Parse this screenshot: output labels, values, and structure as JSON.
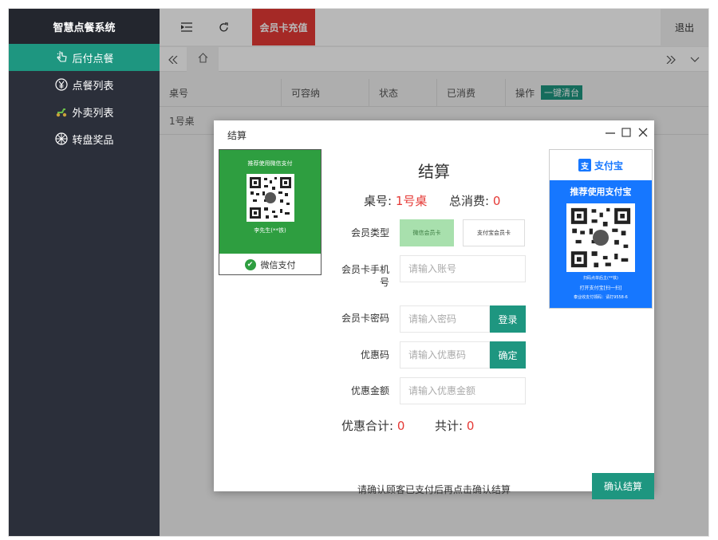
{
  "sidebar": {
    "app_title": "智慧点餐系统",
    "items": [
      {
        "label": "后付点餐",
        "active": true,
        "icon": "hand-pointer-icon"
      },
      {
        "label": "点餐列表",
        "active": false,
        "icon": "yen-icon"
      },
      {
        "label": "外卖列表",
        "active": false,
        "icon": "scooter-icon"
      },
      {
        "label": "转盘奖品",
        "active": false,
        "icon": "wheel-icon"
      }
    ]
  },
  "header": {
    "menu_icon": "menu-fold-icon",
    "refresh_icon": "refresh-icon",
    "recharge_label": "会员卡充值",
    "logout_label": "退出"
  },
  "tabbar": {
    "prev_icon": "double-left-icon",
    "home_icon": "home-icon",
    "next_icon": "double-right-icon",
    "dropdown_icon": "chevron-down-icon"
  },
  "table": {
    "headers": [
      "桌号",
      "可容纳",
      "状态",
      "已消费",
      "操作"
    ],
    "clear_label": "一键清台",
    "rows": [
      {
        "table_no": "1号桌"
      }
    ]
  },
  "dialog": {
    "window_title": "结算",
    "title": "结算",
    "table_label": "桌号:",
    "table_value": "1号桌",
    "total_label": "总消费:",
    "total_value": "0",
    "wechat": {
      "headline": "推荐使用微信支付",
      "payee": "李先生(**铁)",
      "footer": "微信支付"
    },
    "alipay": {
      "brand": "支付宝",
      "headline": "推荐使用支付宝",
      "payee": "扫码点单后主(**铁)",
      "scan_tip": "打开支付宝[扫一扫]",
      "notice": "泰业收支付领码：请打9558-6"
    },
    "form": {
      "member_type_label": "会员类型",
      "member_type_options": [
        "微信会员卡",
        "支付宝会员卡"
      ],
      "phone_label": "会员卡手机号",
      "phone_placeholder": "请输入账号",
      "password_label": "会员卡密码",
      "password_placeholder": "请输入密码",
      "login_label": "登录",
      "coupon_label": "优惠码",
      "coupon_placeholder": "请输入优惠码",
      "coupon_confirm_label": "确定",
      "discount_label": "优惠金额",
      "discount_placeholder": "请输入优惠金额"
    },
    "discount_total_label": "优惠合计:",
    "discount_total_value": "0",
    "grand_total_label": "共计:",
    "grand_total_value": "0",
    "note": "请确认顾客已支付后再点击确认结算",
    "confirm_label": "确认结算"
  },
  "colors": {
    "sidebar_bg": "#2b2f3a",
    "accent_green": "#1e9680",
    "recharge_red": "#e53935",
    "wechat_green": "#2e9e40",
    "alipay_blue": "#1677ff"
  }
}
